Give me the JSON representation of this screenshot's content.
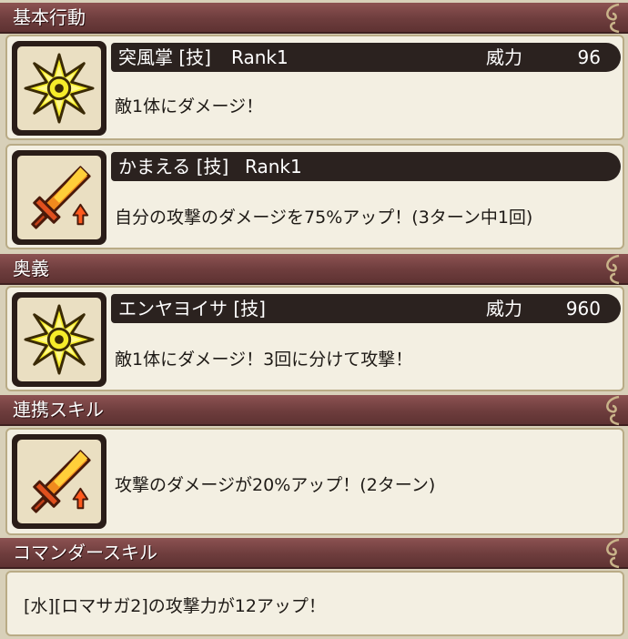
{
  "sections": {
    "basic": "基本行動",
    "ougi": "奥義",
    "renkei": "連携スキル",
    "commander": "コマンダースキル"
  },
  "skills": [
    {
      "name": "突風掌 [技]",
      "rank": "Rank1",
      "power_label": "威力",
      "power": "96",
      "desc": "敵1体にダメージ！",
      "icon": "starburst-attack-icon"
    },
    {
      "name": "かまえる [技]",
      "rank": "Rank1",
      "desc": "自分の攻撃のダメージを75%アップ！(3ターン中1回)",
      "icon": "sword-attack-up-icon"
    },
    {
      "name": "エンヤヨイサ [技]",
      "power_label": "威力",
      "power": "960",
      "desc": "敵1体にダメージ！3回に分けて攻撃！",
      "icon": "starburst-attack-icon"
    },
    {
      "desc": "攻撃のダメージが20%アップ！(2ターン)",
      "icon": "sword-attack-up-icon"
    }
  ],
  "commander": {
    "desc": "[水][ロマサガ2]の攻撃力が12アップ！"
  },
  "colors": {
    "header": "#6e3d3d",
    "title_bar": "#2b221f",
    "card": "#f3efe2",
    "background": "#d8d0b9"
  }
}
